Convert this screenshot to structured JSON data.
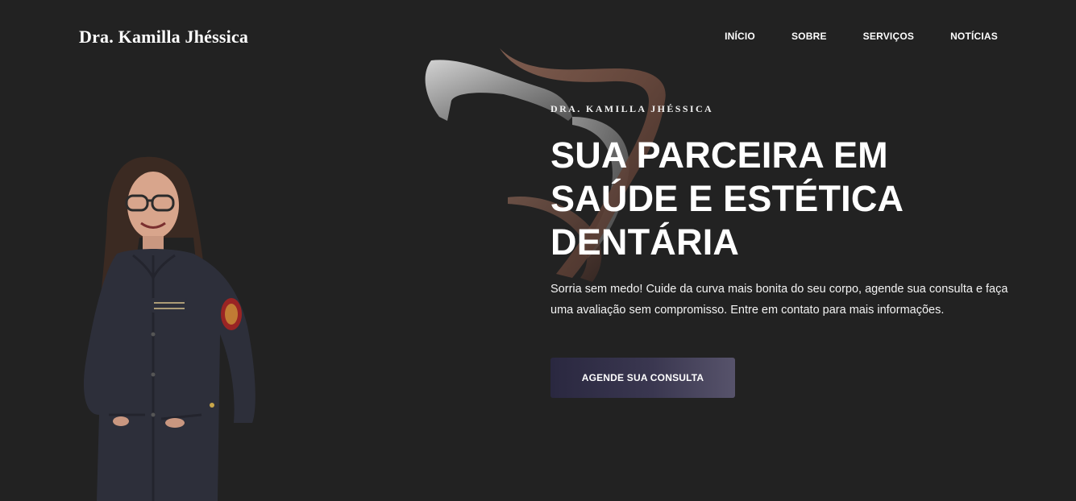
{
  "header": {
    "brand": "Dra. Kamilla Jhéssica",
    "nav": [
      "INÍCIO",
      "SOBRE",
      "SERVIÇOS",
      "NOTÍCIAS"
    ]
  },
  "hero": {
    "eyebrow": "DRA. KAMILLA JHÉSSICA",
    "headline": "SUA PARCEIRA EM SAÚDE E ESTÉTICA DENTÁRIA",
    "lead": "Sorria sem medo! Cuide da curva mais bonita do seu corpo, agende sua consulta e faça uma avaliação sem compromisso. Entre em contato para mais informações.",
    "cta_label": "AGENDE SUA CONSULTA"
  },
  "colors": {
    "background": "#222222",
    "button_start": "#2a2840",
    "button_end": "#57536b",
    "tooth_brown": "#6b4a3e",
    "tooth_silver": "#bdbdbd"
  },
  "icons": {
    "logo": "tooth-logo-icon"
  }
}
